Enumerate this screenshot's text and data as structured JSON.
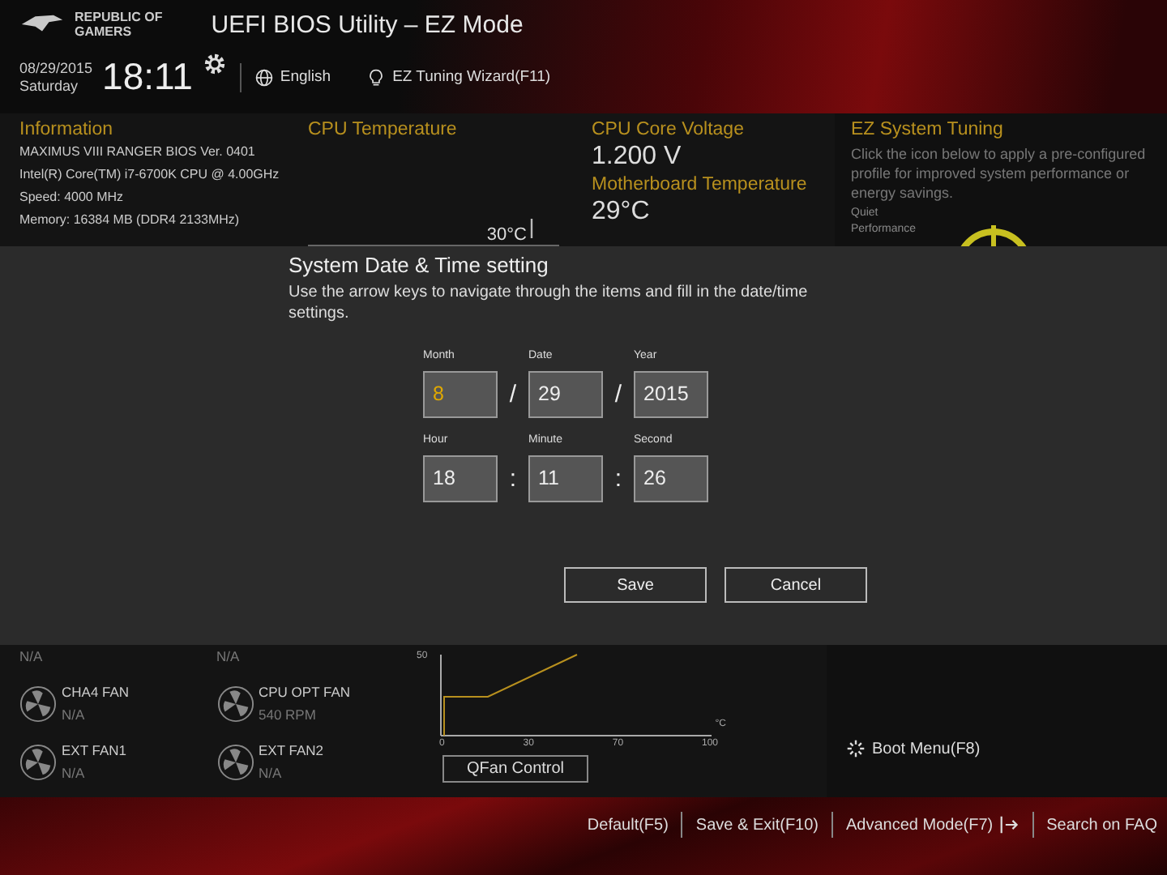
{
  "header": {
    "brand": [
      "REPUBLIC OF",
      "GAMERS"
    ],
    "title": "UEFI BIOS Utility – EZ Mode",
    "date": "08/29/2015",
    "day": "Saturday",
    "time": "18:11",
    "language": "English",
    "wizard": "EZ Tuning Wizard(F11)"
  },
  "information": {
    "title": "Information",
    "lines": [
      "MAXIMUS VIII RANGER    BIOS Ver. 0401",
      "Intel(R) Core(TM) i7-6700K CPU @ 4.00GHz",
      "Speed: 4000 MHz",
      "Memory: 16384 MB (DDR4 2133MHz)"
    ]
  },
  "cpu_temperature": {
    "title": "CPU Temperature",
    "reading": "30°C"
  },
  "cpu_core_voltage": {
    "title": "CPU Core Voltage",
    "reading": "1.200 V"
  },
  "motherboard_temperature": {
    "title": "Motherboard Temperature",
    "reading": "29°C"
  },
  "ez_system_tuning": {
    "title": "EZ System Tuning",
    "description": "Click the icon below to apply a pre-configured profile for improved system performance or energy savings.",
    "profiles": [
      "Quiet",
      "Performance"
    ]
  },
  "dialog": {
    "title": "System Date & Time setting",
    "description": "Use the arrow keys to navigate through the items and fill in the date/time settings.",
    "rows": [
      {
        "separator": "/",
        "fields": [
          {
            "label": "Month",
            "value": "8",
            "selected": true
          },
          {
            "label": "Date",
            "value": "29",
            "selected": false
          },
          {
            "label": "Year",
            "value": "2015",
            "selected": false
          }
        ]
      },
      {
        "separator": ":",
        "fields": [
          {
            "label": "Hour",
            "value": "18",
            "selected": false
          },
          {
            "label": "Minute",
            "value": "11",
            "selected": false
          },
          {
            "label": "Second",
            "value": "26",
            "selected": false
          }
        ]
      }
    ],
    "buttons": [
      "Save",
      "Cancel"
    ]
  },
  "fans": [
    {
      "reading": "N/A"
    },
    {
      "reading": "N/A"
    },
    {
      "name": "CHA4 FAN",
      "reading": "N/A"
    },
    {
      "name": "CPU OPT FAN",
      "reading": "540 RPM"
    },
    {
      "name": "EXT FAN1",
      "reading": "N/A"
    },
    {
      "name": "EXT FAN2",
      "reading": "N/A"
    }
  ],
  "fan_curve": {
    "y_tick": "50",
    "x_ticks": [
      "0",
      "30",
      "70",
      "100"
    ],
    "x_unit": "°C",
    "button": "QFan Control"
  },
  "boot_menu": "Boot Menu(F8)",
  "footer": {
    "items": [
      {
        "label": "Default(F5)",
        "kind": "text"
      },
      {
        "label": "Save & Exit(F10)",
        "kind": "text"
      },
      {
        "label": "Advanced Mode(F7)",
        "kind": "exit"
      },
      {
        "label": "Search on FAQ",
        "kind": "text"
      }
    ]
  }
}
